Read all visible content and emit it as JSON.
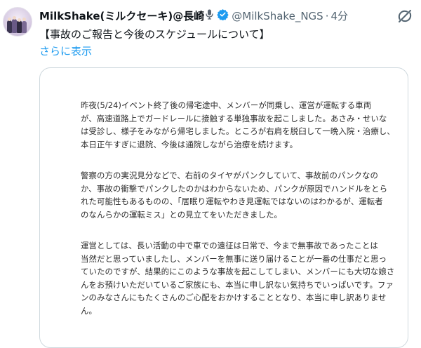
{
  "author": {
    "display_name": "MilkShake(ミルクセーキ)@長崎",
    "handle": "@MilkShake_NGS",
    "time": "4分"
  },
  "tweet": {
    "text": "【事故のご報告と今後のスケジュールについて】",
    "show_more": "さらに表示"
  },
  "icons": {
    "avatar": "group-avatar",
    "mic": "microphone-icon",
    "verified": "verified-badge-icon",
    "more": "grok-slash-icon"
  },
  "colors": {
    "link": "#1d9bf0",
    "secondary": "#536471",
    "verified": "#1d9bf0"
  },
  "statement": {
    "paragraphs": [
      {
        "lines": [
          "昨夜(5/24)イベント終了後の帰宅途中、メンバーが同乗し、運営が運転する車両",
          "が、高速道路上でガードレールに接触する単独事故を起こしました。あさみ・せいな",
          "は受診し、様子をみながら帰宅しました。ところが右肩を脱臼して一晩入院・治療し、",
          "本日正午すぎに退院、今後は通院しながら治療を続けます。"
        ]
      },
      {
        "lines": [
          "警察の方の実況見分などで、右前のタイヤがパンクしていて、事故前のパンクなの",
          "か、事故の衝撃でパンクしたのかはわからないため、パンクが原因でハンドルをとら",
          "れた可能性もあるものの、「居眠り運転やわき見運転ではないのはわかるが、運転者",
          "のなんらかの運転ミス」との見立てをいただきました。"
        ]
      },
      {
        "lines": [
          "運営としては、長い活動の中で車での遠征は日常で、今まで無事故であったことは",
          "当然だと思っていましたし、メンバーを無事に送り届けることが一番の仕事だと思っ",
          "ていたのですが、結果的にこのような事故を起こしてしまい、メンバーにも大切な娘さ",
          "んをお預けいただいているご家族にも、本当に申し訳ない気持ちでいっぱいです。ファ",
          "ンのみなさんにもたくさんのご心配をおかけすることとなり、本当に申し訳ありませ",
          "ん。"
        ]
      }
    ]
  }
}
